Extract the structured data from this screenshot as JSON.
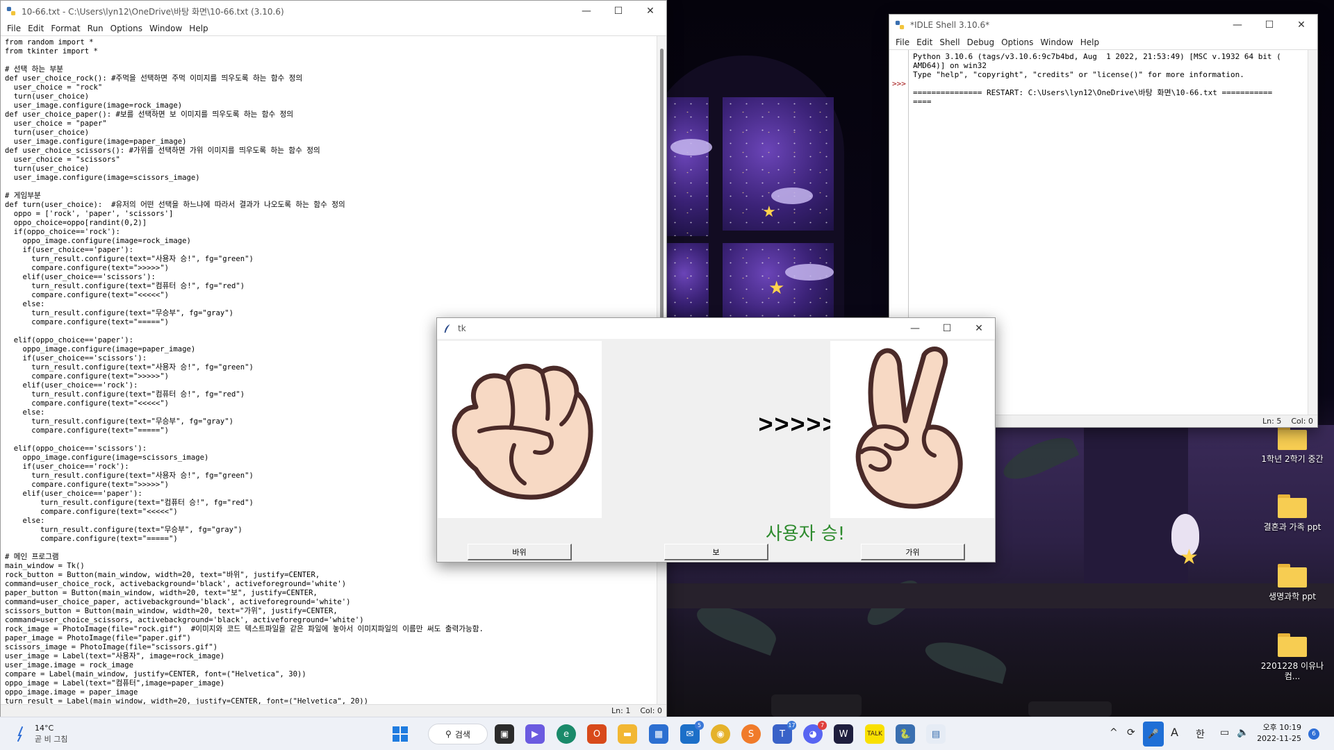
{
  "editor": {
    "title": "10-66.txt - C:\\Users\\lyn12\\OneDrive\\바탕 화면\\10-66.txt (3.10.6)",
    "menu": [
      "File",
      "Edit",
      "Format",
      "Run",
      "Options",
      "Window",
      "Help"
    ],
    "code": "from random import *\nfrom tkinter import *\n\n# 선택 하는 부분\ndef user_choice_rock(): #주먹을 선택하면 주먹 이미지를 띄우도록 하는 함수 정의\n  user_choice = \"rock\"\n  turn(user_choice)\n  user_image.configure(image=rock_image)\ndef user_choice_paper(): #보를 선택하면 보 이미지를 띄우도록 하는 함수 정의\n  user_choice = \"paper\"\n  turn(user_choice)\n  user_image.configure(image=paper_image)\ndef user_choice_scissors(): #가위를 선택하면 가위 이미지를 띄우도록 하는 함수 정의\n  user_choice = \"scissors\"\n  turn(user_choice)\n  user_image.configure(image=scissors_image)\n\n# 게임부분\ndef turn(user_choice):  #유저의 어떤 선택을 하느냐에 따라서 결과가 나오도록 하는 함수 정의\n  oppo = ['rock', 'paper', 'scissors']\n  oppo_choice=oppo[randint(0,2)]\n  if(oppo_choice=='rock'):\n    oppo_image.configure(image=rock_image)\n    if(user_choice=='paper'):\n      turn_result.configure(text=\"사용자 승!\", fg=\"green\")\n      compare.configure(text=\">>>>>\")\n    elif(user_choice=='scissors'):\n      turn_result.configure(text=\"컴퓨터 승!\", fg=\"red\")\n      compare.configure(text=\"<<<<<\")\n    else:\n      turn_result.configure(text=\"무승부\", fg=\"gray\")\n      compare.configure(text=\"=====\")\n\n  elif(oppo_choice=='paper'):\n    oppo_image.configure(image=paper_image)\n    if(user_choice=='scissors'):\n      turn_result.configure(text=\"사용자 승!\", fg=\"green\")\n      compare.configure(text=\">>>>>\")\n    elif(user_choice=='rock'):\n      turn_result.configure(text=\"컴퓨터 승!\", fg=\"red\")\n      compare.configure(text=\"<<<<<\")\n    else:\n      turn_result.configure(text=\"무승부\", fg=\"gray\")\n      compare.configure(text=\"=====\")\n\n  elif(oppo_choice=='scissors'):\n    oppo_image.configure(image=scissors_image)\n    if(user_choice=='rock'):\n      turn_result.configure(text=\"사용자 승!\", fg=\"green\")\n      compare.configure(text=\">>>>>\")\n    elif(user_choice=='paper'):\n        turn_result.configure(text=\"컴퓨터 승!\", fg=\"red\")\n        compare.configure(text=\"<<<<<\")\n    else:\n        turn_result.configure(text=\"무승부\", fg=\"gray\")\n        compare.configure(text=\"=====\")\n\n# 메인 프로그램\nmain_window = Tk()\nrock_button = Button(main_window, width=20, text=\"바위\", justify=CENTER,\ncommand=user_choice_rock, activebackground='black', activeforeground='white')\npaper_button = Button(main_window, width=20, text=\"보\", justify=CENTER,\ncommand=user_choice_paper, activebackground='black', activeforeground='white')\nscissors_button = Button(main_window, width=20, text=\"가위\", justify=CENTER,\ncommand=user_choice_scissors, activebackground='black', activeforeground='white')\nrock_image = PhotoImage(file=\"rock.gif\")  #이미지와 코드 텍스트파일을 같은 파일에 놓아서 이미지파일의 이름만 써도 출력가능함.\npaper_image = PhotoImage(file=\"paper.gif\")\nscissors_image = PhotoImage(file=\"scissors.gif\")\nuser_image = Label(text=\"사용자\", image=rock_image)\nuser_image.image = rock_image\ncompare = Label(main_window, justify=CENTER, font=(\"Helvetica\", 30))\noppo_image = Label(text=\"컴퓨터\",image=paper_image)\noppo_image.image = paper_image\nturn_result = Label(main_window, width=20, justify=CENTER, font=(\"Helvetica\", 20))",
    "status_line": "Ln: 1",
    "status_col": "Col: 0"
  },
  "shell": {
    "title": "*IDLE Shell 3.10.6*",
    "menu": [
      "File",
      "Edit",
      "Shell",
      "Debug",
      "Options",
      "Window",
      "Help"
    ],
    "prompt": ">>>",
    "output": "Python 3.10.6 (tags/v3.10.6:9c7b4bd, Aug  1 2022, 21:53:49) [MSC v.1932 64 bit (\nAMD64)] on win32\nType \"help\", \"copyright\", \"credits\" or \"license()\" for more information.\n\n=============== RESTART: C:\\Users\\lyn12\\OneDrive\\바탕 화면\\10-66.txt ===========\n====",
    "status_line": "Ln: 5",
    "status_col": "Col: 0"
  },
  "tk": {
    "title": "tk",
    "compare": ">>>>>",
    "result": "사용자 승!",
    "result_color": "#2e8b2e",
    "rock_button": "바위",
    "paper_button": "보",
    "scissors_button": "가위",
    "user_image": "rock-fist-icon",
    "oppo_image": "scissors-hand-icon"
  },
  "desktop_icons": [
    {
      "label": "1학년 2학기 중간"
    },
    {
      "label": "결혼과 가족 ppt"
    },
    {
      "label": "생명과학 ppt"
    },
    {
      "label": "2201228 이유나 컴..."
    }
  ],
  "taskbar": {
    "weather_temp": "14°C",
    "weather_cond": "곧 비 그침",
    "search_label": "검색",
    "mail_badge": "5",
    "teams_badge": "17",
    "discord_badge": "7",
    "ime_label": "A",
    "lang_label": "한",
    "time": "오후 10:19",
    "date": "2022-11-25",
    "notification_count": "6"
  },
  "colors": {
    "accent": "#3b78d8",
    "result_green": "#2e8b2e",
    "skin": "#f7d9c4",
    "outline": "#4a2a28"
  }
}
